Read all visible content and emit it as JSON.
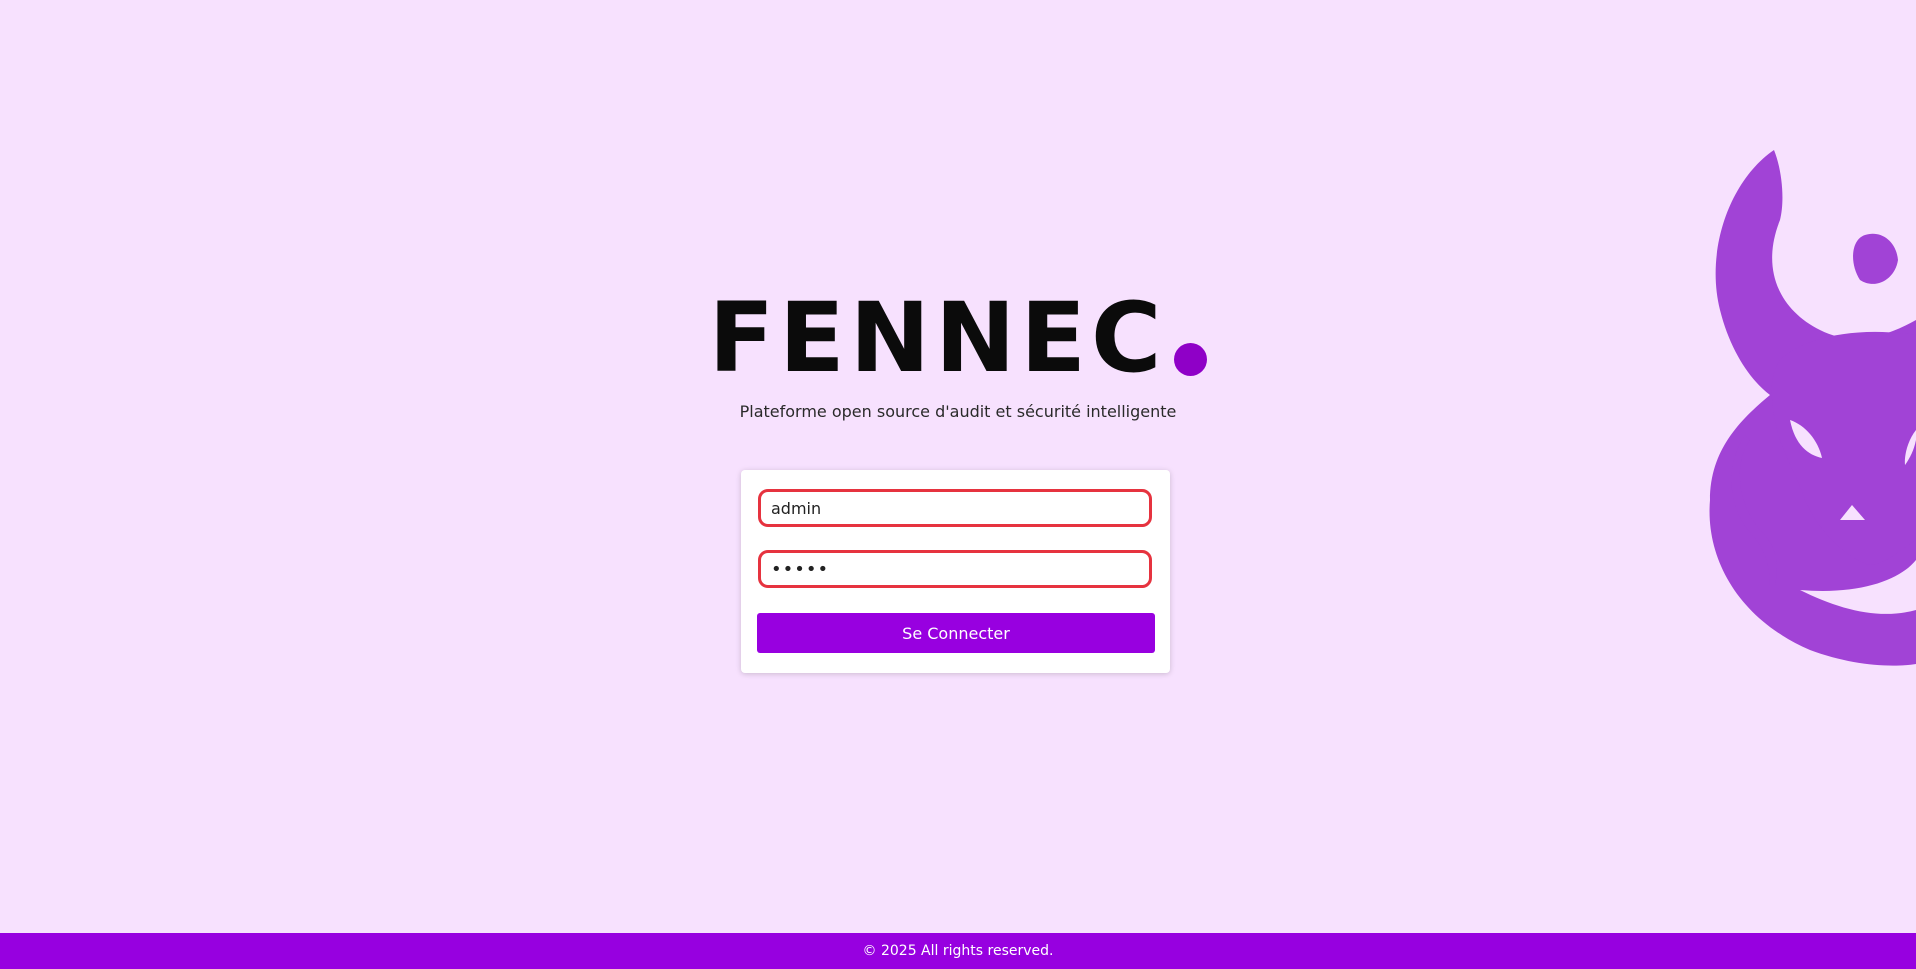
{
  "brand": {
    "logo_text": "FENNEC",
    "tagline": "Plateforme open source d'audit et sécurité intelligente",
    "mascot_icon": "fennec-fox-icon"
  },
  "login": {
    "username_value": "admin",
    "password_value": "admin",
    "submit_label": "Se Connecter"
  },
  "footer": {
    "copyright": "© 2025 All rights reserved."
  },
  "colors": {
    "background": "#f7e1fe",
    "accent": "#9800e0",
    "mascot": "#a143d6",
    "field_border": "#e6333f"
  }
}
